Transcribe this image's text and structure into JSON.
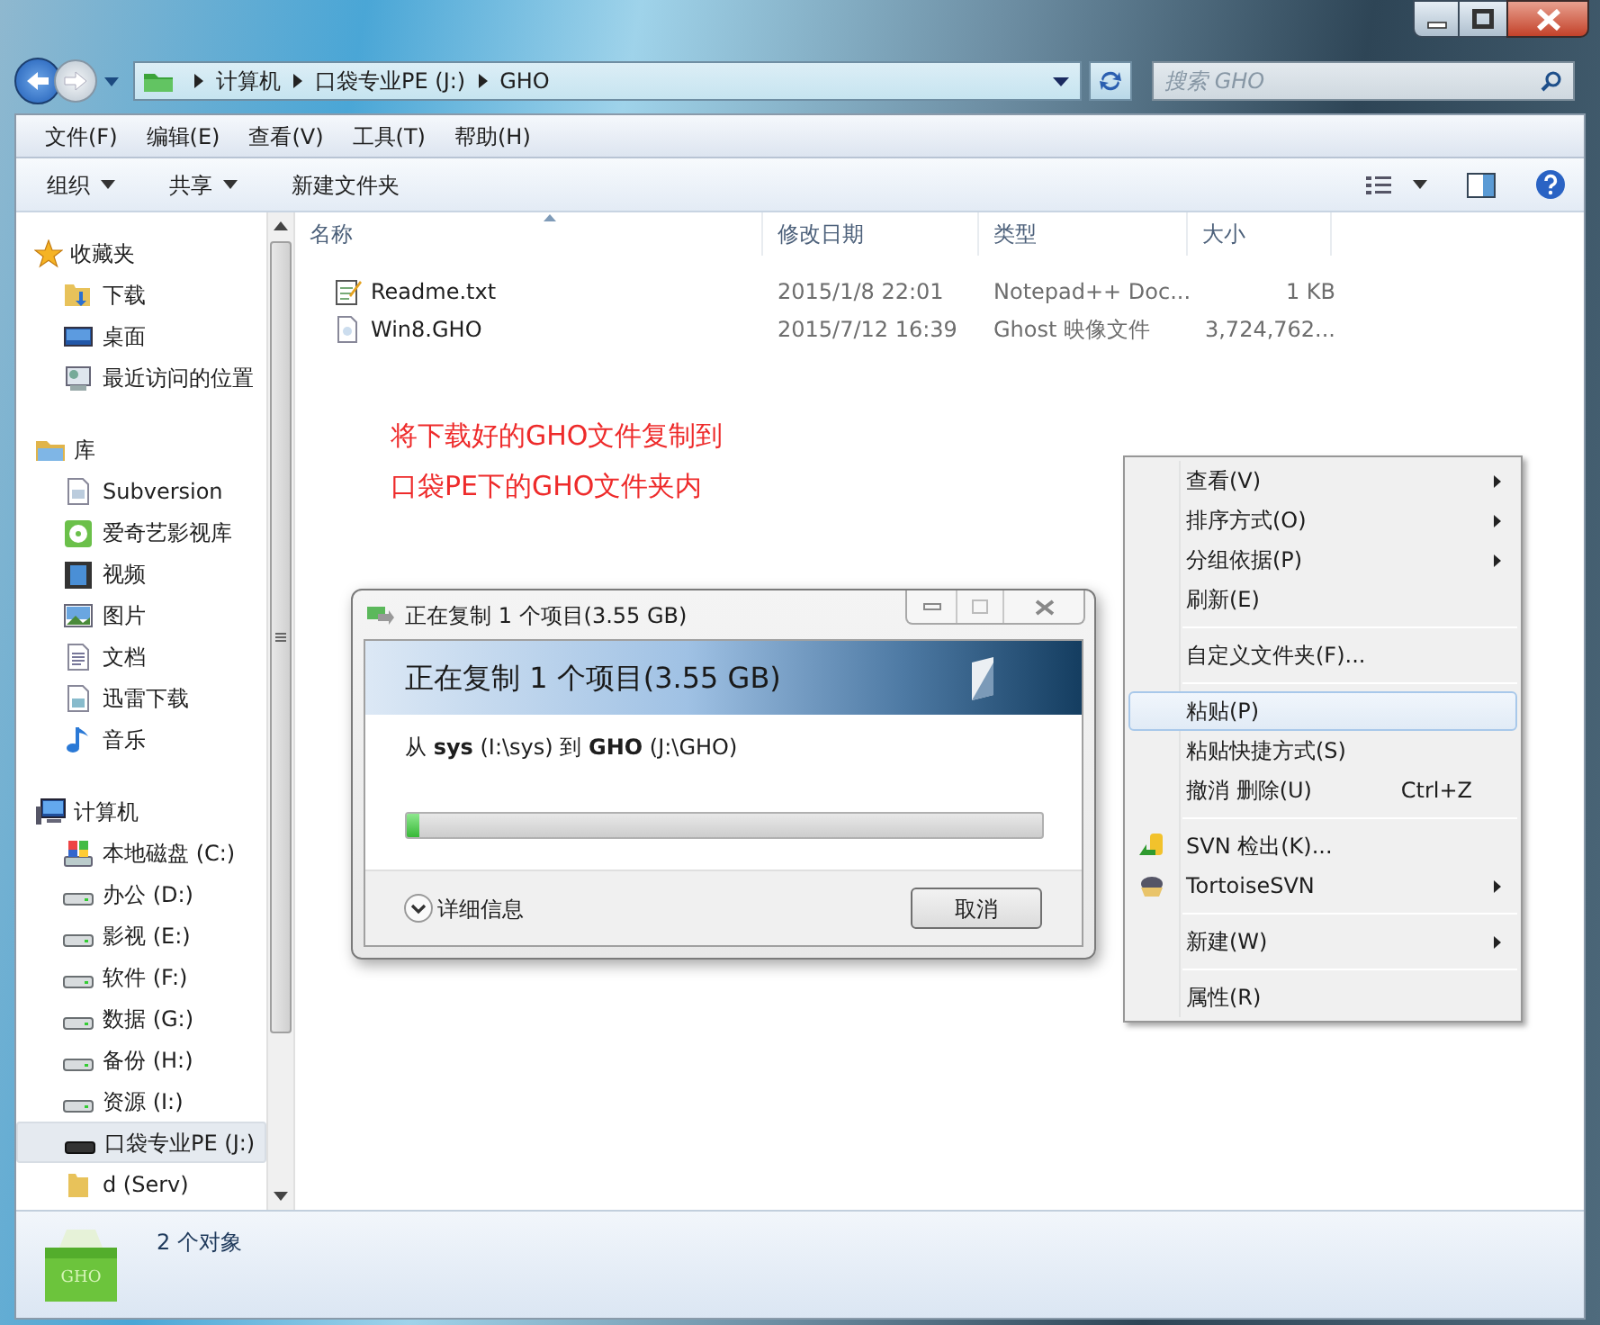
{
  "address": {
    "crumbs": [
      "计算机",
      "口袋专业PE (J:)",
      "GHO"
    ]
  },
  "search": {
    "placeholder": "搜索 GHO"
  },
  "menu_bar": [
    "文件(F)",
    "编辑(E)",
    "查看(V)",
    "工具(T)",
    "帮助(H)"
  ],
  "toolbar": [
    {
      "label": "组织",
      "dropdown": true
    },
    {
      "label": "共享",
      "dropdown": true
    },
    {
      "label": "新建文件夹",
      "dropdown": false
    }
  ],
  "sidebar": {
    "sections": [
      {
        "label": "收藏夹",
        "items": [
          {
            "label": "下载",
            "selected": false
          },
          {
            "label": "桌面",
            "selected": false
          },
          {
            "label": "最近访问的位置",
            "selected": false
          }
        ]
      },
      {
        "label": "库",
        "items": [
          {
            "label": "Subversion",
            "selected": false
          },
          {
            "label": "爱奇艺影视库",
            "selected": false
          },
          {
            "label": "视频",
            "selected": false
          },
          {
            "label": "图片",
            "selected": false
          },
          {
            "label": "文档",
            "selected": false
          },
          {
            "label": "迅雷下载",
            "selected": false
          },
          {
            "label": "音乐",
            "selected": false
          }
        ]
      },
      {
        "label": "计算机",
        "items": [
          {
            "label": "本地磁盘 (C:)",
            "selected": false
          },
          {
            "label": "办公 (D:)",
            "selected": false
          },
          {
            "label": "影视 (E:)",
            "selected": false
          },
          {
            "label": "软件 (F:)",
            "selected": false
          },
          {
            "label": "数据 (G:)",
            "selected": false
          },
          {
            "label": "备份 (H:)",
            "selected": false
          },
          {
            "label": "资源 (I:)",
            "selected": false
          },
          {
            "label": "口袋专业PE (J:)",
            "selected": true
          },
          {
            "label": "d (Serv)",
            "selected": false
          }
        ]
      }
    ]
  },
  "table": {
    "columns": [
      "名称",
      "修改日期",
      "类型",
      "大小"
    ],
    "rows": [
      {
        "cells": [
          "Readme.txt",
          "2015/1/8 22:01",
          "Notepad++ Doc...",
          "1 KB"
        ]
      },
      {
        "cells": [
          "Win8.GHO",
          "2015/7/12 16:39",
          "Ghost 映像文件",
          "3,724,762..."
        ]
      }
    ]
  },
  "annotation": [
    "将下载好的GHO文件复制到",
    "口袋PE下的GHO文件夹内"
  ],
  "dialog": {
    "title": "正在复制 1 个项目(3.55 GB)",
    "heading": "正在复制 1 个项目(3.55 GB)",
    "detail": "从 **sys** (I:\\sys) 到 **GHO** (J:\\GHO)",
    "level": 0.02,
    "more": "详细信息",
    "cancel": "取消"
  },
  "context_menu": [
    {
      "kind": "item",
      "label": "查看(V)",
      "submenu": true,
      "selected": false
    },
    {
      "kind": "item",
      "label": "排序方式(O)",
      "submenu": true,
      "selected": false
    },
    {
      "kind": "item",
      "label": "分组依据(P)",
      "submenu": true,
      "selected": false
    },
    {
      "kind": "item",
      "label": "刷新(E)",
      "submenu": false,
      "selected": false
    },
    {
      "kind": "separator"
    },
    {
      "kind": "item",
      "label": "自定义文件夹(F)...",
      "submenu": false,
      "selected": false
    },
    {
      "kind": "separator"
    },
    {
      "kind": "item",
      "label": "粘贴(P)",
      "submenu": false,
      "selected": true
    },
    {
      "kind": "item",
      "label": "粘贴快捷方式(S)",
      "submenu": false,
      "selected": false
    },
    {
      "kind": "item",
      "label": "撤消 删除(U)",
      "shortcut": "Ctrl+Z",
      "submenu": false,
      "selected": false
    },
    {
      "kind": "separator"
    },
    {
      "kind": "item",
      "label": "SVN 检出(K)...",
      "submenu": false,
      "selected": false,
      "icon": true
    },
    {
      "kind": "item",
      "label": "TortoiseSVN",
      "submenu": true,
      "selected": false,
      "icon": true
    },
    {
      "kind": "separator"
    },
    {
      "kind": "item",
      "label": "新建(W)",
      "submenu": true,
      "selected": false
    },
    {
      "kind": "separator"
    },
    {
      "kind": "item",
      "label": "属性(R)",
      "submenu": false,
      "selected": false
    }
  ],
  "status_bar": {
    "icon_label": "GHO",
    "text": "2 个对象"
  }
}
